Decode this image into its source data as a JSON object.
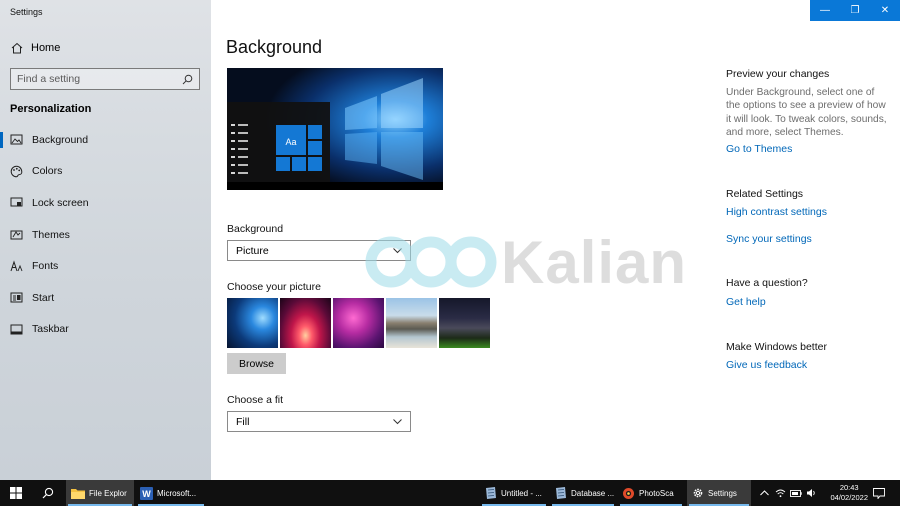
{
  "window": {
    "title": "Settings",
    "controls": {
      "minimize": "—",
      "restore": "❐",
      "close": "✕"
    }
  },
  "sidebar": {
    "home": "Home",
    "search_placeholder": "Find a setting",
    "section": "Personalization",
    "items": [
      {
        "label": "Background",
        "icon": "picture-icon",
        "active": true
      },
      {
        "label": "Colors",
        "icon": "palette-icon"
      },
      {
        "label": "Lock screen",
        "icon": "lock-screen-icon"
      },
      {
        "label": "Themes",
        "icon": "themes-icon"
      },
      {
        "label": "Fonts",
        "icon": "fonts-icon"
      },
      {
        "label": "Start",
        "icon": "start-icon"
      },
      {
        "label": "Taskbar",
        "icon": "taskbar-icon"
      }
    ]
  },
  "main": {
    "title": "Background",
    "preview_tile_text": "Aa",
    "background_label": "Background",
    "background_value": "Picture",
    "choose_picture_label": "Choose your picture",
    "browse_label": "Browse",
    "choose_fit_label": "Choose a fit",
    "fit_value": "Fill"
  },
  "right_panel": {
    "preview_heading": "Preview your changes",
    "preview_text": "Under Background, select one of the options to see a preview of how it will look. To tweak colors, sounds, and more, select Themes.",
    "themes_link": "Go to Themes",
    "related_heading": "Related Settings",
    "high_contrast_link": "High contrast settings",
    "sync_link": "Sync your settings",
    "question_heading": "Have a question?",
    "help_link": "Get help",
    "better_heading": "Make Windows better",
    "feedback_link": "Give us feedback"
  },
  "watermark": {
    "text": "Kalian"
  },
  "taskbar": {
    "apps": [
      {
        "label": "File Explor"
      },
      {
        "label": "Microsoft..."
      },
      {
        "label": "Untitled - ..."
      },
      {
        "label": "Database ..."
      },
      {
        "label": "PhotoSca"
      },
      {
        "label": "Settings"
      }
    ],
    "time": "20:43",
    "date": "04/02/2022"
  },
  "colors": {
    "accent": "#0067b8",
    "titlebar_button": "#0a78d7",
    "taskbar": "#101010"
  }
}
